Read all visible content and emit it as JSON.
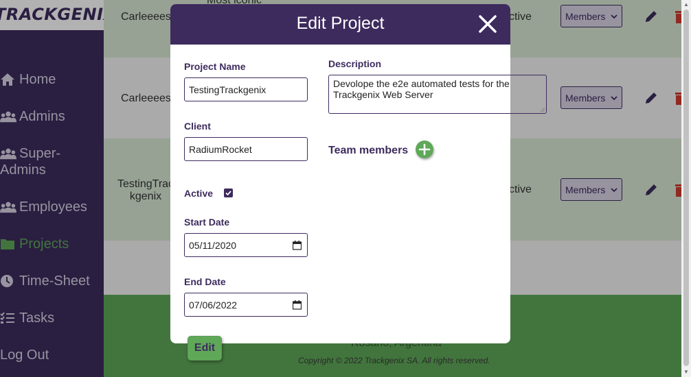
{
  "brand": {
    "logo_text": "TRACKGENIX"
  },
  "sidebar": {
    "items": [
      {
        "label": "Home",
        "icon": "home-icon"
      },
      {
        "label": "Admins",
        "icon": "users-icon"
      },
      {
        "label": "Super-",
        "label2": "Admins",
        "icon": "users-icon"
      },
      {
        "label": "Employees",
        "icon": "users-icon"
      },
      {
        "label": "Projects",
        "icon": "folder-icon",
        "active": true
      },
      {
        "label": "Time-Sheet",
        "icon": "clock-icon"
      },
      {
        "label": "Tasks",
        "icon": "tasks-icon"
      },
      {
        "label": "Log Out",
        "icon": ""
      }
    ],
    "active_color": "#5fa858"
  },
  "table": {
    "rows": [
      {
        "name": "Carleeees",
        "desc": "Most iconic",
        "status": "ctive",
        "members": "Members"
      },
      {
        "name": "Carleeees",
        "desc": "",
        "status": "",
        "members": "Members"
      },
      {
        "name": "TestingTrac",
        "name2": "kgenix",
        "desc": "",
        "status": "ctive",
        "members": "Members"
      }
    ]
  },
  "footer": {
    "location": "Rosario, Argentina",
    "copyright": "Copyright © 2022 Trackgenix SA. All rights reserved."
  },
  "modal": {
    "title": "Edit Project",
    "project_name_label": "Project Name",
    "project_name_value": "TestingTrackgenix",
    "client_label": "Client",
    "client_value": "RadiumRocket",
    "active_label": "Active",
    "active_checked": true,
    "start_date_label": "Start Date",
    "start_date_value": "05/11/2020",
    "end_date_label": "End Date",
    "end_date_value": "07/06/2022",
    "description_label": "Description",
    "description_value": "Devolope the e2e automated tests for the Trackgenix Web Server",
    "team_members_label": "Team members",
    "submit_label": "Edit"
  },
  "colors": {
    "primary": "#3d2b5e",
    "accent": "#5fa858"
  }
}
